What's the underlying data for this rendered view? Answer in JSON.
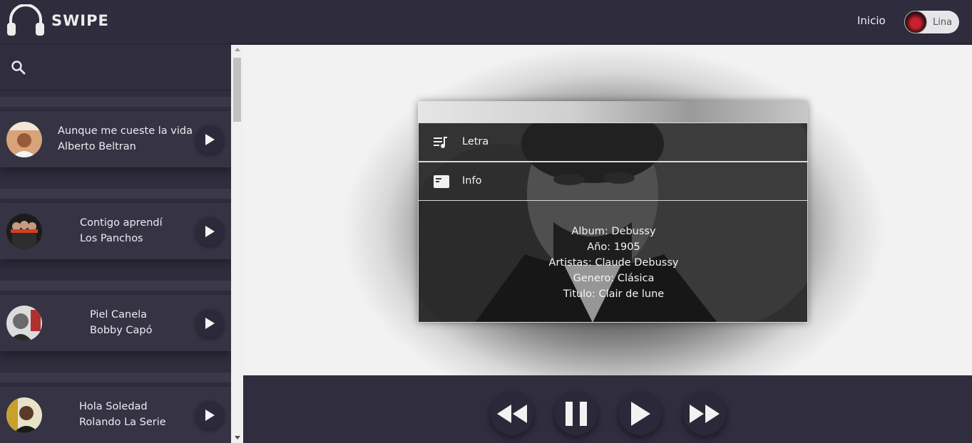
{
  "header": {
    "logo_text": "SWIPE",
    "nav_inicio": "Inicio",
    "user_name": "Lina"
  },
  "sidebar": {
    "search_placeholder": "",
    "songs": [
      {
        "title": "Aunque me cueste la vida",
        "artist": "Alberto Beltran"
      },
      {
        "title": "Contigo aprendí",
        "artist": "Los Panchos"
      },
      {
        "title": "Piel Canela",
        "artist": "Bobby Capó"
      },
      {
        "title": "Hola Soledad",
        "artist": "Rolando La Serie"
      }
    ]
  },
  "panel": {
    "lyrics_label": "Letra",
    "info_label": "Info",
    "info_lines": [
      "Album: Debussy",
      "Año: 1905",
      "Artistas: Claude Debussy",
      "Genero: Clásica",
      "Titulo: Clair de lune"
    ]
  },
  "colors": {
    "background": "#2f2d3e",
    "card": "#353344",
    "text": "#ececf2"
  }
}
